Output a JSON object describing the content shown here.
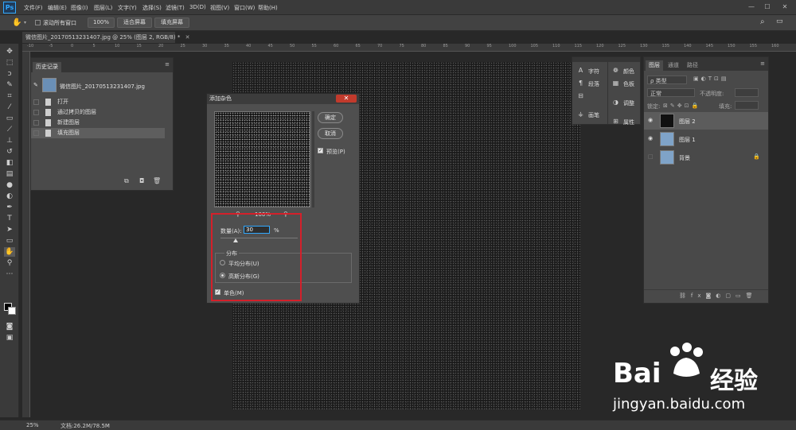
{
  "menubar": {
    "logo": "Ps",
    "items": [
      "文件(F)",
      "编辑(E)",
      "图像(I)",
      "图层(L)",
      "文字(Y)",
      "选择(S)",
      "滤镜(T)",
      "3D(D)",
      "视图(V)",
      "窗口(W)",
      "帮助(H)"
    ],
    "min": "—",
    "max": "☐",
    "close": "✕"
  },
  "optbar": {
    "scroll_all": "滚动所有窗口",
    "zoom": "100%",
    "fit_screen": "适合屏幕",
    "fill_screen": "填充屏幕"
  },
  "doctab": {
    "title": "微信图片_20170513231407.jpg @ 25% (图层 2, RGB/8) *",
    "close": "✕"
  },
  "ruler": {
    "ticks": [
      "-10",
      "-5",
      "0",
      "5",
      "10",
      "15",
      "20",
      "25",
      "30",
      "35",
      "40",
      "45",
      "50",
      "55",
      "60",
      "65",
      "70",
      "75",
      "80",
      "85",
      "90",
      "95",
      "100",
      "105",
      "110",
      "115",
      "120",
      "125",
      "130",
      "135",
      "140",
      "145",
      "150",
      "155",
      "160"
    ]
  },
  "history": {
    "tab": "历史记录",
    "snapshot": "微信图片_20170513231407.jpg",
    "items": [
      "打开",
      "通过拷贝的图层",
      "新建图层",
      "填充图层"
    ]
  },
  "dialog": {
    "title": "添加杂色",
    "ok": "确定",
    "cancel": "取消",
    "preview_label": "预览(P)",
    "zoom": "100%",
    "amount_label": "数量(A):",
    "amount_value": "30",
    "amount_unit": "%",
    "dist_label": "分布",
    "uniform": "平均分布(U)",
    "gaussian": "高斯分布(G)",
    "mono": "单色(M)",
    "amount_fraction": 0.2
  },
  "charpanel": {
    "items": [
      "字符",
      "段落",
      "",
      "画笔",
      "颜色",
      "色板",
      "调整",
      "属性"
    ]
  },
  "layers": {
    "tabs": [
      "图层",
      "通道",
      "路径"
    ],
    "kind": "ρ 类型",
    "blend": "正常",
    "opacity_label": "不透明度:",
    "lock_label": "锁定:",
    "fill_label": "填充:",
    "rows": [
      {
        "name": "图层 2"
      },
      {
        "name": "图层 1"
      },
      {
        "name": "背景"
      }
    ]
  },
  "status": {
    "zoom": "25%",
    "doc": "文档:26.2M/78.5M"
  },
  "watermark": {
    "brand": "Bai",
    "brand2": "经验",
    "url": "jingyan.baidu.com"
  },
  "colors": {
    "accent": "#31a8ff",
    "red": "#d4202a"
  }
}
